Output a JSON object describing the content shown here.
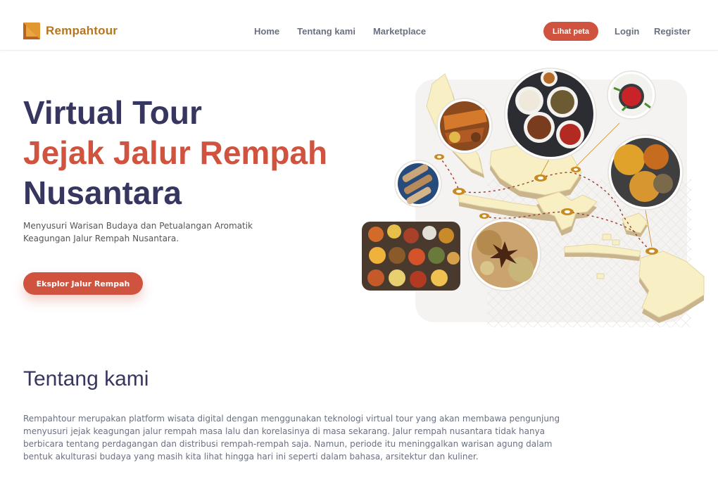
{
  "brand": {
    "name": "Rempahtour",
    "color": "#b5761f",
    "icon": "rempahtour-logo-icon"
  },
  "nav": {
    "links": [
      "Home",
      "Tentang kami",
      "Marketplace"
    ],
    "map_button": "Lihat peta",
    "login": "Login",
    "register": "Register"
  },
  "hero": {
    "title_line1": "Virtual Tour",
    "title_line2": "Jejak Jalur Rempah",
    "title_line3": "Nusantara",
    "subtitle": "Menyusuri Warisan Budaya dan Petualangan Aromatik Keagungan Jalur Rempah Nusantara.",
    "cta": "Eksplor Jalur Rempah",
    "illustration_icon": "indonesia-spice-map-illustration"
  },
  "about": {
    "title": "Tentang kami",
    "text": "Rempahtour merupakan platform wisata digital dengan menggunakan teknologi virtual tour yang akan membawa pengunjung menyusuri jejak keagungan jalur rempah masa lalu dan korelasinya di masa sekarang. Jalur rempah nusantara tidak hanya berbicara tentang perdagangan dan distribusi rempah-rempah saja. Namun, periode itu meninggalkan warisan agung dalam bentuk akulturasi budaya yang masih kita lihat hingga hari ini seperti dalam bahasa, arsitektur dan kuliner."
  },
  "colors": {
    "accent": "#d0533f",
    "navy": "#363660",
    "brand": "#b5761f",
    "muted": "#6b7080",
    "map_land": "#f8efc4"
  }
}
